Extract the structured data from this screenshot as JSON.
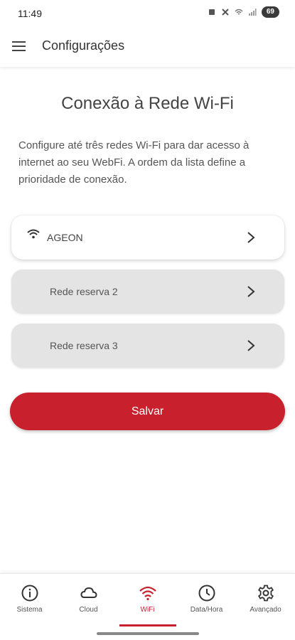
{
  "status_bar": {
    "time": "11:49",
    "battery": "69"
  },
  "app_bar": {
    "title": "Configurações",
    "menu_icon": "menu-icon"
  },
  "page": {
    "heading": "Conexão à Rede Wi-Fi",
    "description": "Configure até três redes Wi-Fi para dar acesso à internet ao seu WebFi. A ordem da lista define a prioridade de conexão."
  },
  "networks": [
    {
      "label": "AGEON",
      "icon": "wifi-icon",
      "active": true
    },
    {
      "label": "Rede reserva 2",
      "active": false
    },
    {
      "label": "Rede reserva 3",
      "active": false
    }
  ],
  "save_label": "Salvar",
  "colors": {
    "accent": "#c8202c",
    "inactive_card": "#e4e4e4"
  },
  "bottom_nav": {
    "selected": "WiFi",
    "items": [
      {
        "label": "Sistema",
        "icon": "info-icon"
      },
      {
        "label": "Cloud",
        "icon": "cloud-icon"
      },
      {
        "label": "WiFi",
        "icon": "wifi-icon"
      },
      {
        "label": "Data/Hora",
        "icon": "clock-icon"
      },
      {
        "label": "Avançado",
        "icon": "gear-icon"
      }
    ]
  }
}
